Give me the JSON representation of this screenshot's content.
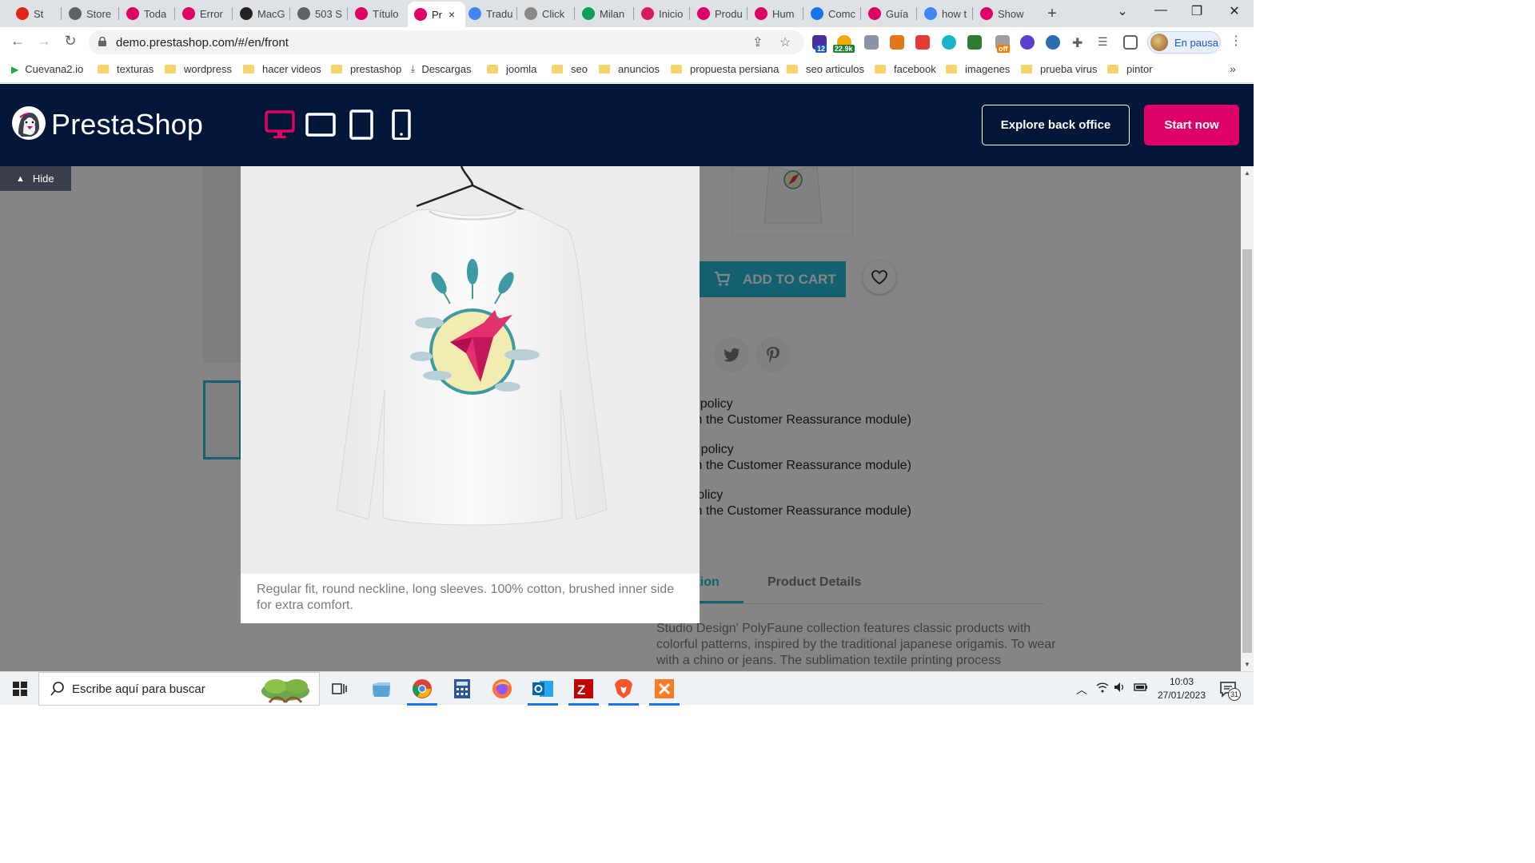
{
  "browser": {
    "tabs": [
      {
        "label": "St",
        "color": "#e2231a"
      },
      {
        "label": "Store",
        "color": "#5f6368"
      },
      {
        "label": "Toda",
        "color": "#df0067"
      },
      {
        "label": "Error",
        "color": "#df0067"
      },
      {
        "label": "MacG",
        "color": "#222222"
      },
      {
        "label": "503 S",
        "color": "#5f6368"
      },
      {
        "label": "Título",
        "color": "#df0067"
      },
      {
        "label": "Pr",
        "color": "#df0067"
      },
      {
        "label": "Tradu",
        "color": "#4285f4"
      },
      {
        "label": "Click",
        "color": "#888888"
      },
      {
        "label": "Milan",
        "color": "#0f9d58"
      },
      {
        "label": "Inicio",
        "color": "#d81b60"
      },
      {
        "label": "Produ",
        "color": "#df0067"
      },
      {
        "label": "Hum",
        "color": "#df0067"
      },
      {
        "label": "Comc",
        "color": "#1a73e8"
      },
      {
        "label": "Guía",
        "color": "#df0067"
      },
      {
        "label": "how t",
        "color": "#4285f4"
      },
      {
        "label": "Show",
        "color": "#df0067"
      }
    ],
    "active_tab_close": "×",
    "new_tab": "+",
    "url": "demo.prestashop.com/#/en/front",
    "profile_label": "En pausa",
    "ext_badges": {
      "twelve": "12",
      "count": "22.9k",
      "off": "off"
    },
    "bookmarks": [
      {
        "label": "Cuevana2.io",
        "kind": "site"
      },
      {
        "label": "texturas",
        "kind": "folder"
      },
      {
        "label": "wordpress",
        "kind": "folder"
      },
      {
        "label": "hacer videos",
        "kind": "folder"
      },
      {
        "label": "prestashop",
        "kind": "folder"
      },
      {
        "label": "Descargas",
        "kind": "download"
      },
      {
        "label": "joomla",
        "kind": "folder"
      },
      {
        "label": "seo",
        "kind": "folder"
      },
      {
        "label": "anuncios",
        "kind": "folder"
      },
      {
        "label": "propuesta persiana",
        "kind": "folder"
      },
      {
        "label": "seo articulos",
        "kind": "folder"
      },
      {
        "label": "facebook",
        "kind": "folder"
      },
      {
        "label": "imagenes",
        "kind": "folder"
      },
      {
        "label": "prueba virus",
        "kind": "folder"
      },
      {
        "label": "pintor",
        "kind": "folder"
      }
    ],
    "bookmarks_more": "»"
  },
  "demo_header": {
    "logo_text": "PrestaShop",
    "devices": [
      "desktop-icon",
      "tablet-landscape-icon",
      "tablet-portrait-icon",
      "mobile-icon"
    ],
    "explore_label": "Explore back office",
    "start_label": "Start now",
    "hide_label": "Hide"
  },
  "product_page": {
    "add_to_cart": "ADD TO CART",
    "reassurance": [
      {
        "title": "rity policy",
        "sub": "with the Customer Reassurance module)"
      },
      {
        "title": "ery policy",
        "sub": "with the Customer Reassurance module)"
      },
      {
        "title": "n policy",
        "sub": "with the Customer Reassurance module)"
      }
    ],
    "tab_description": "ription",
    "tab_details": "Product Details",
    "description": "Studio Design' PolyFaune collection features classic products with colorful patterns, inspired by the traditional japanese origamis. To wear with a chino or jeans. The sublimation textile printing process"
  },
  "modal": {
    "caption": "Regular fit, round neckline, long sleeves. 100% cotton, brushed inner side for extra comfort."
  },
  "taskbar": {
    "search_placeholder": "Escribe aquí para buscar",
    "time": "10:03",
    "date": "27/01/2023",
    "notifications": "31"
  },
  "colors": {
    "brand_pink": "#df0067",
    "brand_navy": "#011638",
    "accent_cyan": "#24b9d7"
  }
}
